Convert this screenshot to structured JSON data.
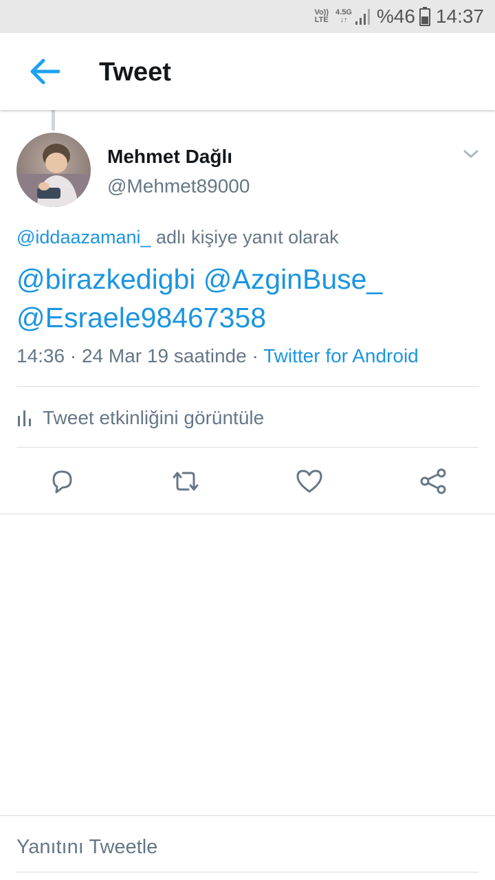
{
  "status_bar": {
    "volte_top": "Vo))",
    "volte_bottom": "LTE",
    "network": "4.5G",
    "battery": "%46",
    "time": "14:37"
  },
  "header": {
    "title": "Tweet",
    "back_icon": "arrow-left-icon"
  },
  "tweet": {
    "author_name": "Mehmet Dağlı",
    "author_handle": "@Mehmet89000",
    "reply_to_handle": "@iddaazamani_",
    "reply_to_suffix": " adlı kişiye yanıt olarak",
    "text_line1": "@birazkedigbi @AzginBuse_",
    "text_line2": "@Esraele98467358",
    "time": "14:36",
    "separator1": " · ",
    "date": "24 Mar 19 saatinde",
    "separator2": " · ",
    "source": "Twitter for Android",
    "activity_label": "Tweet etkinliğini görüntüle"
  },
  "actions": [
    {
      "name": "reply",
      "icon": "reply-icon"
    },
    {
      "name": "retweet",
      "icon": "retweet-icon"
    },
    {
      "name": "like",
      "icon": "heart-icon"
    },
    {
      "name": "share",
      "icon": "share-icon"
    }
  ],
  "compose": {
    "placeholder": "Yanıtını Tweetle"
  },
  "colors": {
    "accent": "#1b95e0",
    "secondary_text": "#657786",
    "divider": "#d6dde3"
  }
}
